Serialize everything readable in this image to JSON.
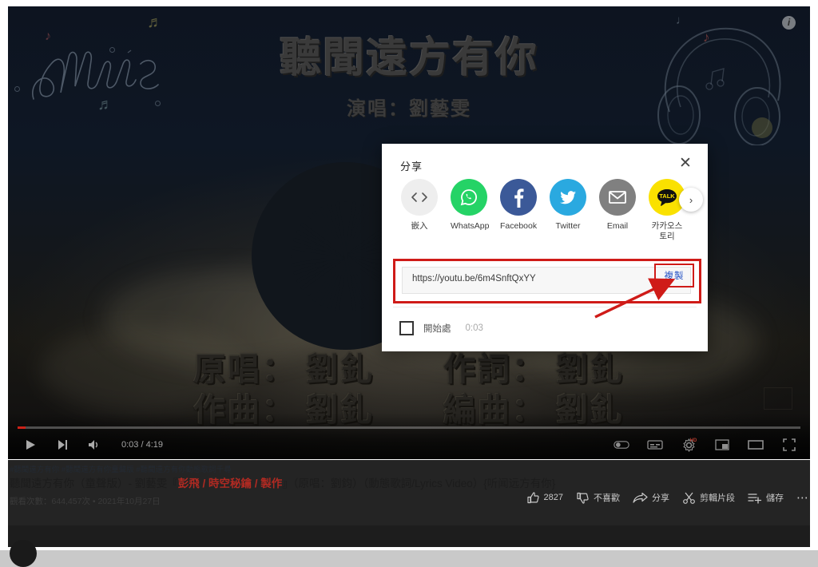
{
  "video": {
    "overlay_title": "聽聞遠方有你",
    "overlay_subtitle": "演唱：劉藝雯",
    "credits": [
      {
        "label": "原唱：",
        "name": "劉釓"
      },
      {
        "label": "作詞：",
        "name": "劉釓"
      },
      {
        "label": "作曲：",
        "name": "劉釓"
      },
      {
        "label": "編曲：",
        "name": "劉釓"
      }
    ],
    "logo_text": "Music",
    "info_icon_glyph": "i"
  },
  "player": {
    "current_time": "0:03",
    "duration": "4:19",
    "time_display": "0:03 / 4:19",
    "progress_percent": 1,
    "quality_badge": "HD",
    "controls_left": [
      {
        "name": "play-button",
        "icon": "play-icon"
      },
      {
        "name": "next-button",
        "icon": "next-icon"
      },
      {
        "name": "volume-button",
        "icon": "volume-icon"
      }
    ],
    "controls_right": [
      {
        "name": "autoplay-toggle",
        "icon": "autoplay-toggle-icon"
      },
      {
        "name": "subtitles-button",
        "icon": "subtitles-icon"
      },
      {
        "name": "settings-button",
        "icon": "gear-icon"
      },
      {
        "name": "miniplayer-button",
        "icon": "miniplayer-icon"
      },
      {
        "name": "theater-button",
        "icon": "theater-icon"
      },
      {
        "name": "fullscreen-button",
        "icon": "fullscreen-icon"
      }
    ]
  },
  "share_dialog": {
    "title": "分享",
    "close_glyph": "✕",
    "next_glyph": "›",
    "targets": [
      {
        "label": "嵌入",
        "icon": "embed-code-icon",
        "bg": "#eeeeee",
        "fg": "#555555"
      },
      {
        "label": "WhatsApp",
        "icon": "whatsapp-icon",
        "bg": "#25D366",
        "fg": "#ffffff"
      },
      {
        "label": "Facebook",
        "icon": "facebook-icon",
        "bg": "#3b5998",
        "fg": "#ffffff"
      },
      {
        "label": "Twitter",
        "icon": "twitter-icon",
        "bg": "#2aa9e0",
        "fg": "#ffffff"
      },
      {
        "label": "Email",
        "icon": "email-icon",
        "bg": "#808080",
        "fg": "#ffffff"
      },
      {
        "label": "카카오스토리",
        "icon": "kakaostory-icon",
        "bg": "#FAE100",
        "fg": "#000000"
      }
    ],
    "kakao_glyph": "TALK",
    "url": "https://youtu.be/6m4SnftQxYY",
    "copy_label": "複製",
    "start_at_label": "開始處",
    "start_at_time": "0:03",
    "highlight_color": "#cf1b18"
  },
  "meta": {
    "hashtags": "#聽聞遠方有你 #聽聞遠方有你童聲版 #聽聞遠方有你動態歌詞千尋",
    "title_plain_1": "聽聞遠方有你（童聲版）- 劉藝雯『",
    "title_red": "彭飛 / 時空秘鑰 / 製作",
    "title_plain_2": "』（原唱：劉鈞）（動態歌詞/Lyrics Video）{听闻远方有你}",
    "views": "觀看次數：644,457次 • 2021年10月27日",
    "actions": [
      {
        "name": "like-button",
        "icon": "thumbs-up-icon",
        "label": "2827"
      },
      {
        "name": "dislike-button",
        "icon": "thumbs-down-icon",
        "label": "不喜歡"
      },
      {
        "name": "share-button",
        "icon": "share-arrow-icon",
        "label": "分享"
      },
      {
        "name": "clip-button",
        "icon": "scissors-icon",
        "label": "剪輯片段"
      },
      {
        "name": "save-button",
        "icon": "playlist-add-icon",
        "label": "儲存"
      },
      {
        "name": "more-button",
        "icon": "ellipsis-icon",
        "label": "⋯"
      }
    ]
  }
}
